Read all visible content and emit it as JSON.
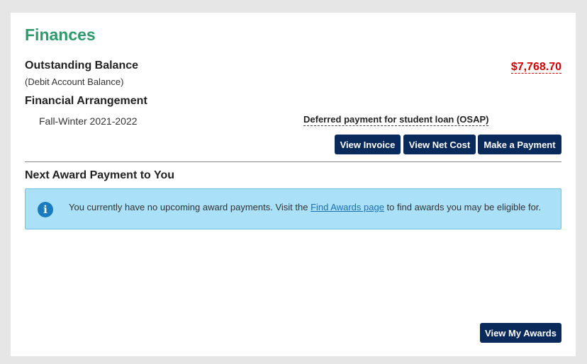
{
  "finances": {
    "title": "Finances",
    "outstanding": {
      "heading": "Outstanding Balance",
      "sub": "(Debit Account Balance)",
      "amount": "$7,768.70"
    },
    "arrangement": {
      "heading": "Financial Arrangement",
      "term": "Fall-Winter 2021-2022",
      "type": "Deferred payment for student loan (OSAP)"
    },
    "buttons": {
      "view_invoice": "View Invoice",
      "view_net_cost": "View Net Cost",
      "make_payment": "Make a Payment"
    },
    "award": {
      "heading": "Next Award Payment to You",
      "alert_before": "You currently have no upcoming award payments. Visit the ",
      "alert_link": "Find Awards page",
      "alert_after": " to find awards you may be eligible for.",
      "view_awards": "View My Awards"
    }
  },
  "colors": {
    "title": "#2e9a6b",
    "balance": "#d40000",
    "button": "#0a2a5c",
    "alert_bg": "#abe1f8",
    "info_icon": "#1a7bbf"
  },
  "icons": {
    "info": "info-circle-icon"
  }
}
